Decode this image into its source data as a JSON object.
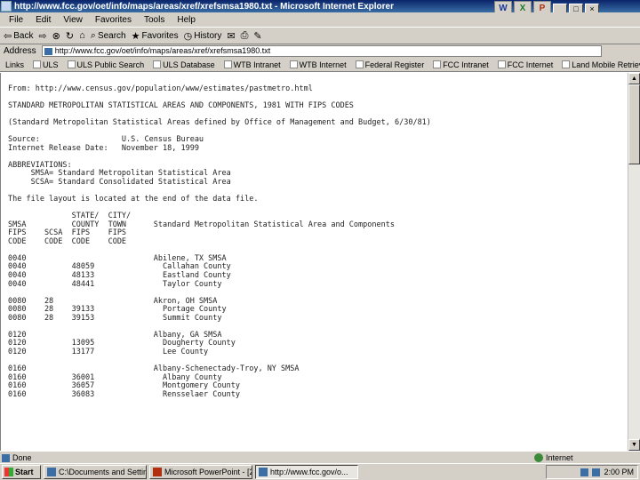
{
  "window": {
    "title": "http://www.fcc.gov/oet/info/maps/areas/xref/xrefsmsa1980.txt - Microsoft Internet Explorer",
    "controls": [
      "_",
      "□",
      "×"
    ]
  },
  "office_bar": [
    "W",
    "X",
    "P"
  ],
  "menu": [
    "File",
    "Edit",
    "View",
    "Favorites",
    "Tools",
    "Help"
  ],
  "toolbar": {
    "back": "Back",
    "search": "Search",
    "favorites": "Favorites",
    "history": "History"
  },
  "address": {
    "label": "Address",
    "url": "http://www.fcc.gov/oet/info/maps/areas/xref/xrefsmsa1980.txt"
  },
  "links": {
    "label": "Links",
    "items": [
      "ULS",
      "ULS Public Search",
      "ULS Database",
      "WTB Intranet",
      "WTB Internet",
      "Federal Register",
      "FCC Intranet",
      "FCC Internet",
      "Land Mobile Retrieval"
    ]
  },
  "document": {
    "lines": [
      "From: http://www.census.gov/population/www/estimates/pastmetro.html",
      "",
      "STANDARD METROPOLITAN STATISTICAL AREAS AND COMPONENTS, 1981 WITH FIPS CODES",
      "",
      "(Standard Metropolitan Statistical Areas defined by Office of Management and Budget, 6/30/81)",
      "",
      "Source:                  U.S. Census Bureau",
      "Internet Release Date:   November 18, 1999",
      "",
      "ABBREVIATIONS:",
      "     SMSA= Standard Metropolitan Statistical Area",
      "     SCSA= Standard Consolidated Statistical Area",
      "",
      "The file layout is located at the end of the data file.",
      "",
      "              STATE/  CITY/",
      "SMSA          COUNTY  TOWN      Standard Metropolitan Statistical Area and Components",
      "FIPS    SCSA  FIPS    FIPS",
      "CODE    CODE  CODE    CODE",
      "",
      "0040                            Abilene, TX SMSA",
      "0040          48059               Callahan County",
      "0040          48133               Eastland County",
      "0040          48441               Taylor County",
      "",
      "0080    28                      Akron, OH SMSA",
      "0080    28    39133               Portage County",
      "0080    28    39153               Summit County",
      "",
      "0120                            Albany, GA SMSA",
      "0120          13095               Dougherty County",
      "0120          13177               Lee County",
      "",
      "0160                            Albany-Schenectady-Troy, NY SMSA",
      "0160          36001               Albany County",
      "0160          36057               Montgomery County",
      "0160          36083               Rensselaer County"
    ]
  },
  "status": {
    "left": "Done",
    "zone": "Internet"
  },
  "taskbar": {
    "start": "Start",
    "tasks": [
      "C:\\Documents and Settin...",
      "Microsoft PowerPoint - [2...",
      "http://www.fcc.gov/o..."
    ],
    "clock": "2:00 PM"
  }
}
